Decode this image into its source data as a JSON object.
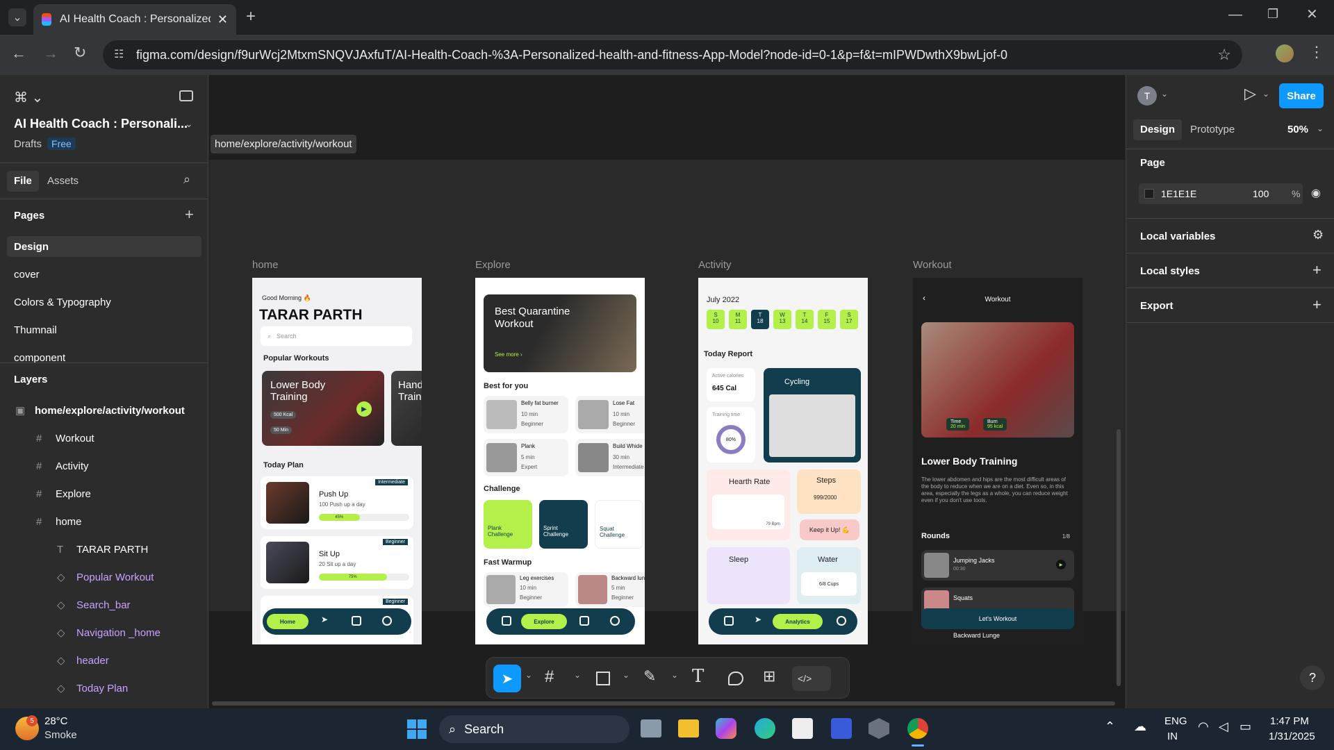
{
  "browser": {
    "tab_title": "AI Health Coach : Personalized",
    "url": "figma.com/design/f9urWcj2MtxmSNQVJAxfuT/AI-Health-Coach-%3A-Personalized-health-and-fitness-App-Model?node-id=0-1&p=f&t=mIPWDwthX9bwLjof-0"
  },
  "file": {
    "name": "AI Health Coach : Personali...",
    "location": "Drafts",
    "plan": "Free",
    "tabs": [
      "File",
      "Assets"
    ]
  },
  "pages": {
    "title": "Pages",
    "items": [
      "Design",
      "cover",
      "Colors & Typography",
      "Thumnail",
      "component"
    ]
  },
  "layers": {
    "title": "Layers",
    "root": "home/explore/activity/workout",
    "frames": [
      "Workout",
      "Activity",
      "Explore",
      "home"
    ],
    "children": [
      "TARAR PARTH",
      "Popular Workout",
      "Search_bar",
      "Navigation _home",
      "header",
      "Today Plan"
    ]
  },
  "canvas": {
    "tooltip": "home/explore/activity/workout",
    "frame_labels": [
      "home",
      "Explore",
      "Activity",
      "Workout"
    ]
  },
  "home_frame": {
    "greeting": "Good Morning 🔥",
    "name": "TARAR PARTH",
    "search": "Search",
    "popular": "Popular Workouts",
    "card1": "Lower Body Training",
    "card1_kcal": "500 Kcal",
    "card1_min": "50 Min",
    "card2": "Hand Training",
    "today": "Today Plan",
    "plan1": "Push Up",
    "plan1_sub": "100 Push up a day",
    "plan1_tag": "Intermediate",
    "plan1_pct": "45%",
    "plan2": "Sit Up",
    "plan2_sub": "20 Sit up a day",
    "plan2_tag": "Beginner",
    "plan2_pct": "75%",
    "plan3_tag": "Beginner",
    "nav": "Home"
  },
  "explore_frame": {
    "hero": "Best Quarantine Workout",
    "see_more": "See more ›",
    "best": "Best for you",
    "items": [
      {
        "t": "Belly fat burner",
        "d": "10 min",
        "l": "Beginner"
      },
      {
        "t": "Lose Fat",
        "d": "10 min",
        "l": "Beginner"
      },
      {
        "t": "Plank",
        "d": "5 min",
        "l": "Expert"
      },
      {
        "t": "Build Whide",
        "d": "30 min",
        "l": "Intermediate"
      }
    ],
    "challenge": "Challenge",
    "ch": [
      "Plank Challenge",
      "Sprint Challenge",
      "Squat Challenge"
    ],
    "warmup": "Fast Warmup",
    "wu": [
      {
        "t": "Leg exercises",
        "d": "10 min",
        "l": "Beginner"
      },
      {
        "t": "Backward lun",
        "d": "5 min",
        "l": "Beginner"
      }
    ],
    "nav": "Explore"
  },
  "activity_frame": {
    "month": "July 2022",
    "days": [
      [
        "S",
        "10"
      ],
      [
        "M",
        "11"
      ],
      [
        "T",
        "18"
      ],
      [
        "W",
        "13"
      ],
      [
        "T",
        "14"
      ],
      [
        "F",
        "15"
      ],
      [
        "S",
        "17"
      ]
    ],
    "report": "Today Report",
    "cal_label": "Active calories",
    "cal": "645 Cal",
    "cycling": "Cycling",
    "train": "Training time",
    "train_pct": "80%",
    "heart": "Hearth Rate",
    "bpm": "79 Bpm",
    "steps": "Steps",
    "steps_val": "999/2000",
    "keep": "Keep it Up! 💪",
    "sleep": "Sleep",
    "water": "Water",
    "cups": "6/8 Cups",
    "nav": "Analytics"
  },
  "workout_frame": {
    "title": "Workout",
    "time_l": "Time",
    "time": "20 min",
    "burn_l": "Burn",
    "burn": "95 kcal",
    "heading": "Lower Body Training",
    "desc": "The lower abdomen and hips are the most difficult areas of the body to reduce when we are on a diet. Even so, in this area, especially the legs as a whole, you can reduce weight even if you don't use tools.",
    "rounds": "Rounds",
    "count": "1/8",
    "r1": "Jumping Jacks",
    "r1t": "00:30",
    "r2": "Squats",
    "cta": "Let's Workout",
    "r3": "Backward Lunge"
  },
  "right": {
    "avatar": "T",
    "tabs": [
      "Design",
      "Prototype"
    ],
    "zoom": "50%",
    "share": "Share",
    "page": "Page",
    "bg_hex": "1E1E1E",
    "opacity": "100",
    "pct": "%",
    "sections": [
      "Local variables",
      "Local styles",
      "Export"
    ]
  },
  "taskbar": {
    "temp": "28°C",
    "weather": "Smoke",
    "badge": "5",
    "search": "Search",
    "lang": "ENG",
    "region": "IN",
    "time": "1:47 PM",
    "date": "1/31/2025"
  },
  "colors": {
    "accent": "#b4f04a",
    "teal": "#123d4d",
    "figma_blue": "#0d99ff",
    "layer_purple": "#c9a2ff"
  }
}
